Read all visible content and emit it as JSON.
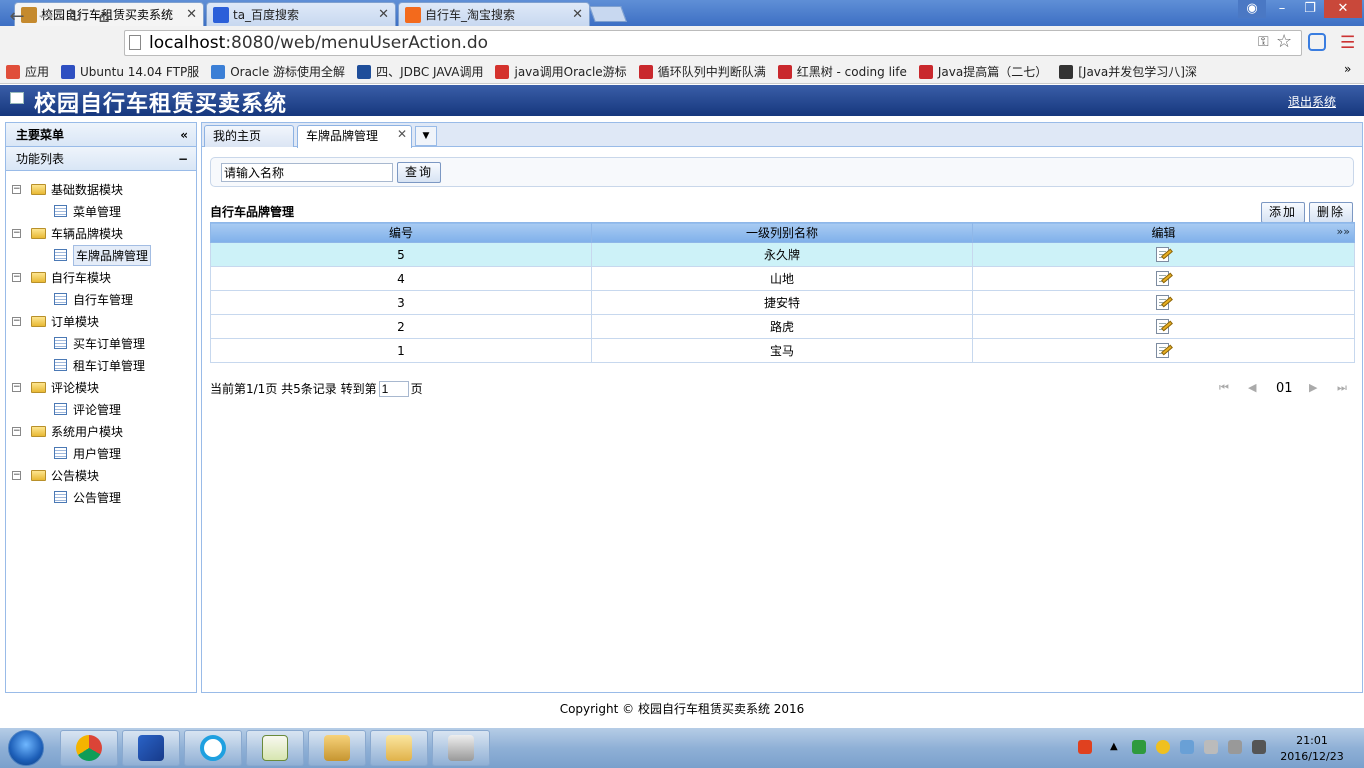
{
  "browser": {
    "tabs": [
      {
        "title": "校园自行车租赁买卖系统",
        "close": "✕",
        "favicon_color": "#c58a2e"
      },
      {
        "title": "ta_百度搜索",
        "close": "✕",
        "favicon_color": "#2b5fd9"
      },
      {
        "title": "自行车_淘宝搜索",
        "close": "✕",
        "favicon_color": "#f36a1c"
      }
    ],
    "url_host": "localhost",
    "url_rest": ":8080/web/menuUserAction.do",
    "bookmarks": [
      {
        "label": "应用",
        "color": "#e04e3a"
      },
      {
        "label": "Ubuntu 14.04 FTP服",
        "color": "#2e4fc1"
      },
      {
        "label": "Oracle 游标使用全解",
        "color": "#3b7fd6"
      },
      {
        "label": "四、JDBC JAVA调用",
        "color": "#1f4e9a"
      },
      {
        "label": "java调用Oracle游标",
        "color": "#d4322d"
      },
      {
        "label": "循环队列中判断队满",
        "color": "#c9282d"
      },
      {
        "label": "红黑树 - coding life",
        "color": "#c9282d"
      },
      {
        "label": "Java提高篇（二七）",
        "color": "#c9282d"
      },
      {
        "label": "[Java并发包学习八]深",
        "color": "#333333"
      }
    ]
  },
  "app": {
    "title": "校园自行车租赁买卖系统",
    "logout": "退出系统"
  },
  "sidebar": {
    "header": "主要菜单",
    "collapse_icon": "«",
    "section": "功能列表",
    "section_icon": "−",
    "tree": [
      {
        "label": "基础数据模块",
        "children": [
          "菜单管理"
        ]
      },
      {
        "label": "车辆品牌模块",
        "children": [
          "车牌品牌管理"
        ]
      },
      {
        "label": "自行车模块",
        "children": [
          "自行车管理"
        ]
      },
      {
        "label": "订单模块",
        "children": [
          "买车订单管理",
          "租车订单管理"
        ]
      },
      {
        "label": "评论模块",
        "children": [
          "评论管理"
        ]
      },
      {
        "label": "系统用户模块",
        "children": [
          "用户管理"
        ]
      },
      {
        "label": "公告模块",
        "children": [
          "公告管理"
        ]
      }
    ],
    "selected": "车牌品牌管理"
  },
  "main": {
    "tabs": [
      "我的主页",
      "车牌品牌管理"
    ],
    "tab_close": "✕",
    "search_placeholder": "请输入名称",
    "search_button": "查询",
    "grid_title": "自行车品牌管理",
    "add_button": "添加",
    "delete_button": "删除",
    "columns": [
      "编号",
      "一级列别名称",
      "编辑"
    ],
    "rows": [
      {
        "id": "5",
        "name": "永久牌"
      },
      {
        "id": "4",
        "name": "山地"
      },
      {
        "id": "3",
        "name": "捷安特"
      },
      {
        "id": "2",
        "name": "路虎"
      },
      {
        "id": "1",
        "name": "宝马"
      }
    ],
    "pager": {
      "info": "当前第1/1页  共5条记录  转到第",
      "jump_value": "1",
      "suffix": "页",
      "page": "01"
    }
  },
  "footer": "Copyright © 校园自行车租赁买卖系统 2016",
  "taskbar": {
    "time": "21:01",
    "date": "2016/12/23"
  }
}
